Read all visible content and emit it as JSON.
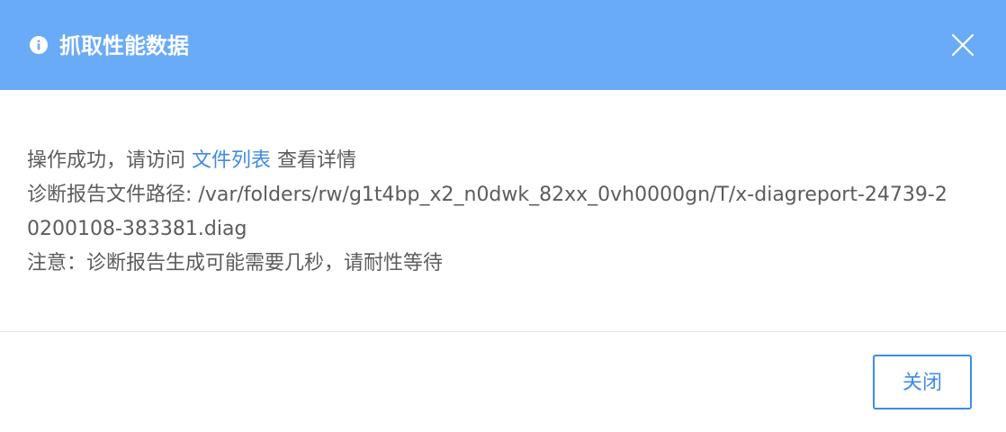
{
  "dialog": {
    "title": "抓取性能数据",
    "info_icon": "info-icon",
    "close_icon": "close-icon",
    "header_color": "#6aabf7",
    "accent_color": "#3f8be6"
  },
  "message": {
    "success_prefix": "操作成功，请访问 ",
    "success_link": "文件列表",
    "success_suffix": " 查看详情",
    "path_label": "诊断报告文件路径: ",
    "path_value": "/var/folders/rw/g1t4bp_x2_n0dwk_82xx_0vh0000gn/T/x-diagreport-24739-20200108-383381.diag",
    "notice": "注意：诊断报告生成可能需要几秒，请耐性等待"
  },
  "footer": {
    "close_label": "关闭"
  }
}
